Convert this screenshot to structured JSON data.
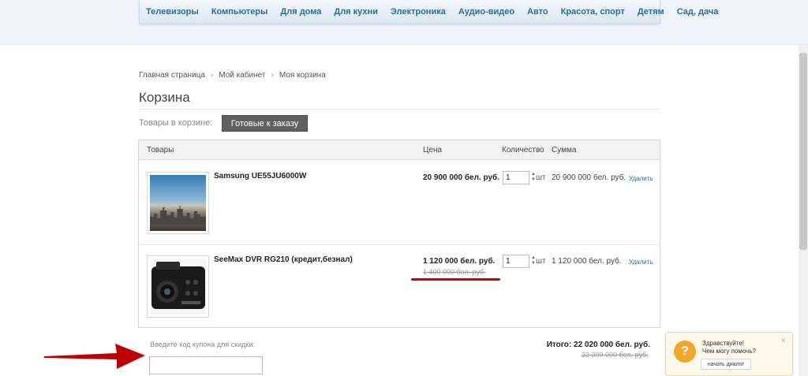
{
  "nav": {
    "items": [
      "Телевизоры",
      "Компьютеры",
      "Для дома",
      "Для кухни",
      "Электроника",
      "Аудио-видео",
      "Авто",
      "Красота, спорт",
      "Детям",
      "Сад, дача"
    ]
  },
  "breadcrumb": {
    "home": "Главная страница",
    "account": "Мой кабинет",
    "current": "Моя корзина",
    "separator": "›"
  },
  "page": {
    "title": "Корзина"
  },
  "cart": {
    "label": "Товары в корзине:",
    "ready_button": "Готовые к заказу",
    "headers": {
      "product": "Товары",
      "price": "Цена",
      "quantity": "Количество",
      "sum": "Сумма"
    },
    "items": [
      {
        "name": "Samsung UE55JU6000W",
        "price": "20 900 000 бел. руб.",
        "old_price": "",
        "qty": "1",
        "unit": "шт",
        "sum": "20 900 000 бел. руб.",
        "delete": "Удалить",
        "icon": "tv-product-image"
      },
      {
        "name": "SeeMax DVR RG210 (кредит,безнал)",
        "price": "1 120 000 бел. руб.",
        "old_price": "1 400 000 бел. руб.",
        "qty": "1",
        "unit": "шт",
        "sum": "1 120 000 бел. руб.",
        "delete": "Удалить",
        "icon": "dvr-product-image"
      }
    ],
    "coupon_label": "Введите код купона для скидки:",
    "total_label": "Итого:",
    "total_value": "22 020 000 бел. руб.",
    "old_total": "22 300 000 бел. руб."
  },
  "chat": {
    "greeting": "Здравствуйте!",
    "help": "Чем могу помочь?",
    "button": "начать диалог",
    "icon_glyph": "?",
    "close_glyph": "×"
  },
  "colors": {
    "accent_link": "#2d6a9f",
    "annotation_red": "#cc0000",
    "button_dark": "#606060",
    "chat_icon": "#f2a72c"
  }
}
